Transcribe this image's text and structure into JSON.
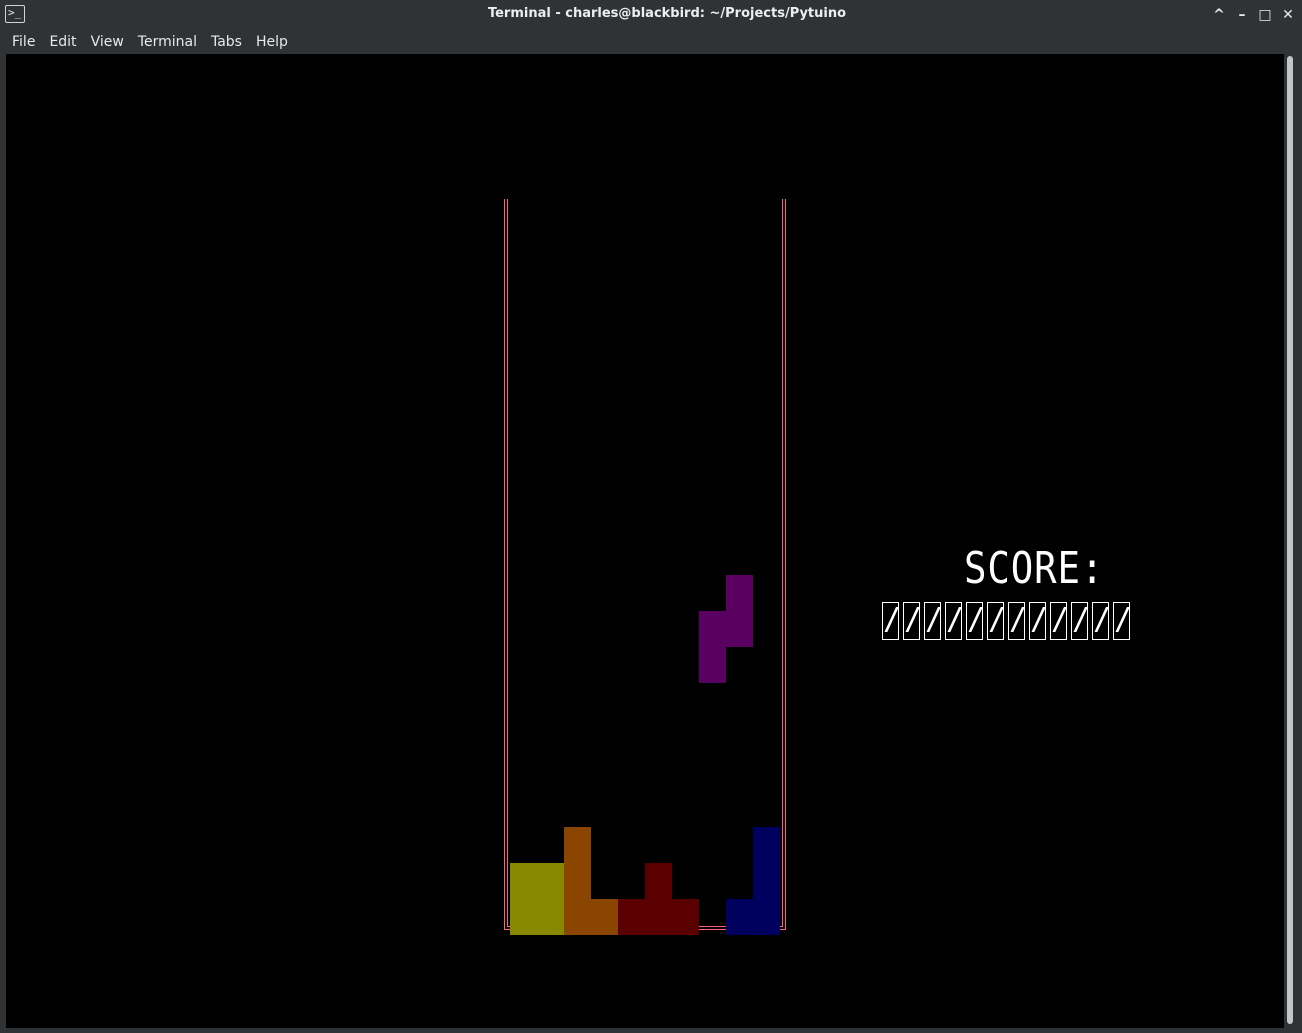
{
  "window": {
    "title": "Terminal - charles@blackbird: ~/Projects/Pytuino",
    "app_icon_glyph": ">_",
    "controls": {
      "keep_above": "^",
      "minimize": "–",
      "maximize": "□",
      "close": "✕"
    }
  },
  "menubar": {
    "items": [
      "File",
      "Edit",
      "View",
      "Terminal",
      "Tabs",
      "Help"
    ]
  },
  "game": {
    "score_label": "SCORE:",
    "score_digits": [
      "/",
      "/",
      "/",
      "/",
      "/",
      "/",
      "/",
      "/",
      "/",
      "/",
      "/",
      "/"
    ],
    "colors": {
      "border": "#ff5f7a",
      "yellow": "#888800",
      "orange": "#8a4500",
      "red": "#5a0000",
      "blue": "#00005e",
      "purple": "#5a0060",
      "background": "#000000"
    },
    "falling_piece": {
      "type": "S",
      "color": "purple",
      "cells": [
        [
          8,
          11
        ],
        [
          8,
          12
        ],
        [
          7,
          12
        ],
        [
          7,
          13
        ]
      ]
    },
    "stack": [
      {
        "color": "yellow",
        "cells": [
          [
            0,
            19
          ],
          [
            1,
            19
          ],
          [
            0,
            20
          ],
          [
            1,
            20
          ]
        ]
      },
      {
        "color": "orange",
        "cells": [
          [
            2,
            18
          ],
          [
            2,
            19
          ],
          [
            2,
            20
          ],
          [
            3,
            20
          ]
        ]
      },
      {
        "color": "red",
        "cells": [
          [
            5,
            19
          ],
          [
            4,
            20
          ],
          [
            5,
            20
          ],
          [
            6,
            20
          ]
        ]
      },
      {
        "color": "blue",
        "cells": [
          [
            9,
            18
          ],
          [
            9,
            19
          ],
          [
            9,
            20
          ],
          [
            8,
            20
          ]
        ]
      }
    ]
  }
}
